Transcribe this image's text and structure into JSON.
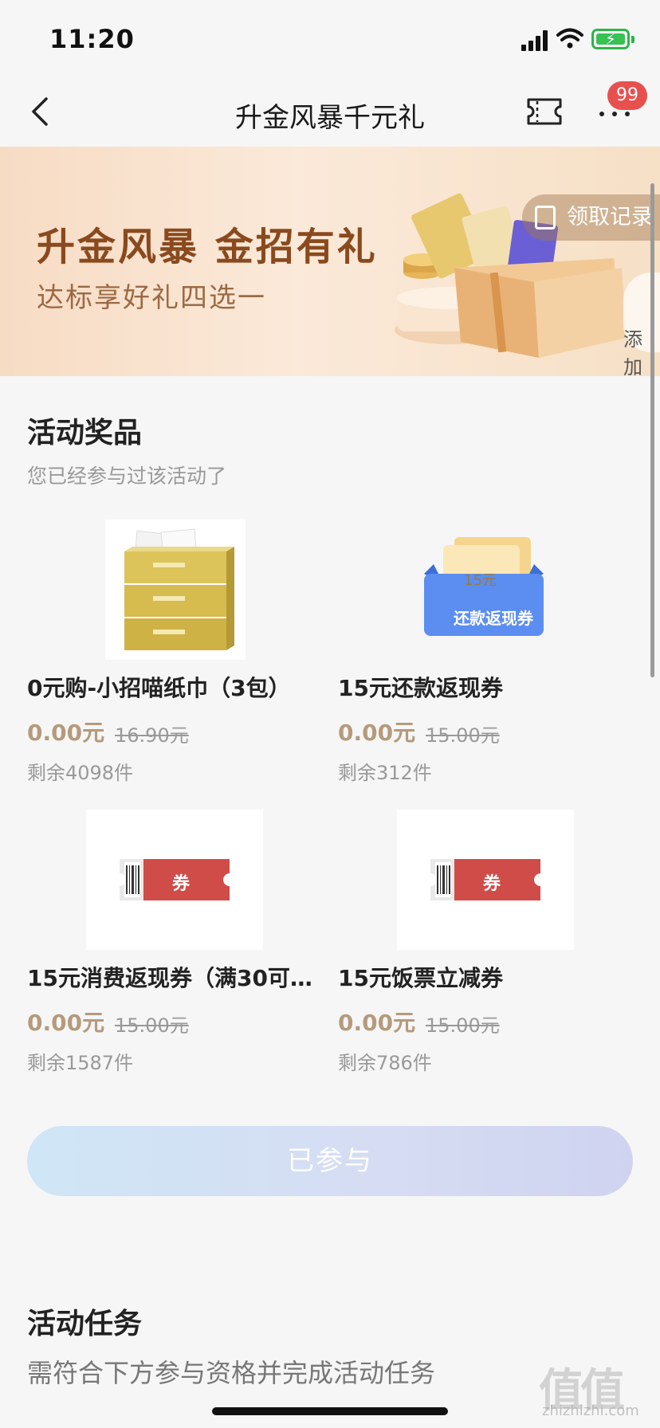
{
  "status_bar": {
    "time": "11:20"
  },
  "nav": {
    "title": "升金风暴千元礼",
    "badge_count": "99"
  },
  "banner": {
    "title": "升金风暴 金招有礼",
    "subtitle": "达标享好礼四选一",
    "records_label": "领取记录",
    "side_label": "添加"
  },
  "prizes_section": {
    "title": "活动奖品",
    "subtitle": "您已经参与过该活动了",
    "items": [
      {
        "name": "0元购-小招喵纸巾（3包）",
        "price": "0.00元",
        "original_price": "16.90元",
        "stock": "剩余4098件",
        "image_icon": "tissue-pack-image"
      },
      {
        "name": "15元还款返现券",
        "price": "0.00元",
        "original_price": "15.00元",
        "stock": "剩余312件",
        "image_icon": "repayment-voucher-image",
        "voucher_amount": "15元",
        "voucher_label": "还款返现券"
      },
      {
        "name": "15元消费返现券（满30可…",
        "price": "0.00元",
        "original_price": "15.00元",
        "stock": "剩余1587件",
        "image_icon": "coupon-ticket-image",
        "ticket_label": "券"
      },
      {
        "name": "15元饭票立减券",
        "price": "0.00元",
        "original_price": "15.00元",
        "stock": "剩余786件",
        "image_icon": "coupon-ticket-image",
        "ticket_label": "券"
      }
    ]
  },
  "joined_button": {
    "label": "已参与"
  },
  "tasks_section": {
    "title": "活动任务",
    "subtitle": "需符合下方参与资格并完成活动任务"
  },
  "watermark": {
    "text": "值值值",
    "sub": "zhizhizhi.com"
  },
  "colors": {
    "accent_price": "#b59a7c",
    "badge": "#e8504e",
    "ticket_red": "#cf4c48",
    "voucher_blue": "#5b8ef0"
  }
}
